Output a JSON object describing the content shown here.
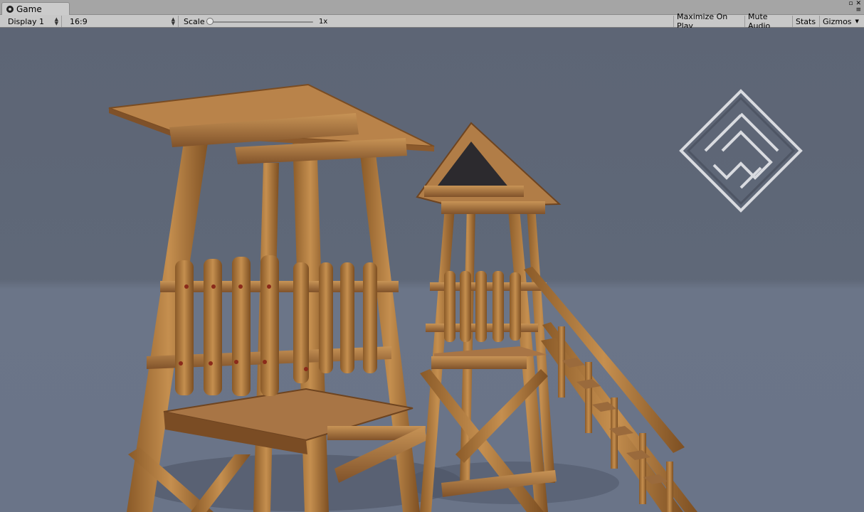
{
  "window": {
    "tab_title": "Game",
    "tab_icon": "unity-icon",
    "controls": {
      "maximize": "▫",
      "close": "✕",
      "menu": "≡"
    }
  },
  "toolbar": {
    "display": "Display 1",
    "aspect": "16:9",
    "scale_label": "Scale",
    "scale_value": "1x",
    "scale_level": 0,
    "maximize_on_play": "Maximize On Play",
    "mute_audio": "Mute Audio",
    "stats": "Stats",
    "gizmos": "Gizmos"
  },
  "scene": {
    "sky_color": "#5d6575",
    "ground_color": "#6b7588",
    "wood_color": "#b07a3e",
    "logo": "maze-diamond-logo"
  }
}
